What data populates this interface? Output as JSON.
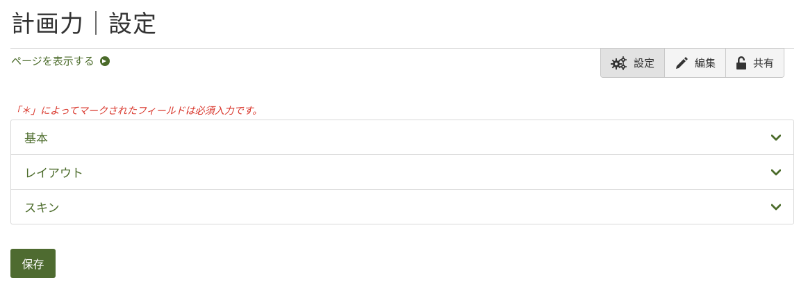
{
  "page": {
    "title": "計画力｜設定",
    "view_link_label": "ページを表示する"
  },
  "toolbar": {
    "buttons": [
      {
        "label": "設定",
        "icon": "gears-icon",
        "active": true
      },
      {
        "label": "編集",
        "icon": "pencil-icon",
        "active": false
      },
      {
        "label": "共有",
        "icon": "unlock-icon",
        "active": false
      }
    ]
  },
  "form": {
    "required_note": "「＊」によってマークされたフィールドは必須入力です。",
    "sections": [
      {
        "label": "基本"
      },
      {
        "label": "レイアウト"
      },
      {
        "label": "スキン"
      }
    ],
    "save_label": "保存"
  },
  "colors": {
    "accent_green": "#4e6b30",
    "link_green": "#4b6b2a",
    "required_red": "#d9362b"
  }
}
